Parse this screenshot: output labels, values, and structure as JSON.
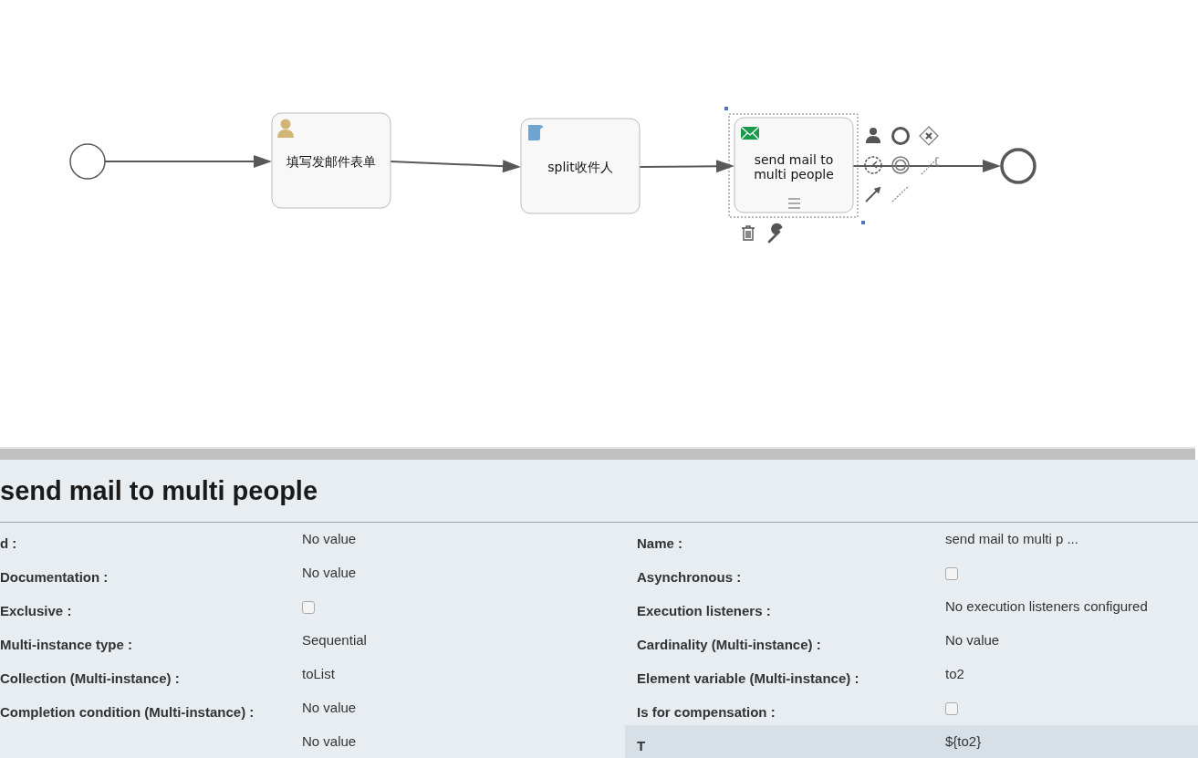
{
  "diagram": {
    "nodes": [
      {
        "kind": "start_event"
      },
      {
        "kind": "user_task",
        "name": "填写发邮件表单",
        "selected": false,
        "sequential": false
      },
      {
        "kind": "script_task",
        "name": "split收件人",
        "selected": false,
        "sequential": false
      },
      {
        "kind": "mail_task",
        "name": "send mail to multi people",
        "selected": true,
        "sequential": true
      },
      {
        "kind": "end_event"
      }
    ]
  },
  "properties": {
    "title": "send mail to multi people",
    "rows": [
      {
        "left": {
          "label": "d :",
          "kind": "text",
          "value": "No value"
        },
        "right": {
          "label": "Name :",
          "kind": "text",
          "value": "send mail to multi p ..."
        }
      },
      {
        "left": {
          "label": "Documentation :",
          "kind": "text",
          "value": "No value"
        },
        "right": {
          "label": "Asynchronous :",
          "kind": "checkbox",
          "checked": false
        }
      },
      {
        "left": {
          "label": "Exclusive :",
          "kind": "checkbox",
          "checked": false
        },
        "right": {
          "label": "Execution listeners :",
          "kind": "text",
          "value": "No execution listeners configured"
        }
      },
      {
        "left": {
          "label": "Multi-instance type :",
          "kind": "text",
          "value": "Sequential"
        },
        "right": {
          "label": "Cardinality (Multi-instance) :",
          "kind": "text",
          "value": "No value"
        }
      },
      {
        "left": {
          "label": "Collection (Multi-instance) :",
          "kind": "text",
          "value": "toList"
        },
        "right": {
          "label": "Element variable (Multi-instance) :",
          "kind": "text",
          "value": "to2"
        }
      },
      {
        "left": {
          "label": "Completion condition (Multi-instance) :",
          "kind": "text",
          "value": "No value"
        },
        "right": {
          "label": "Is for compensation :",
          "kind": "checkbox",
          "checked": false
        }
      },
      {
        "left": {
          "kind": "text",
          "value": "No value"
        },
        "right": {
          "label": "T",
          "kind": "text",
          "value": "${to2}",
          "highlighted": true
        }
      }
    ]
  }
}
